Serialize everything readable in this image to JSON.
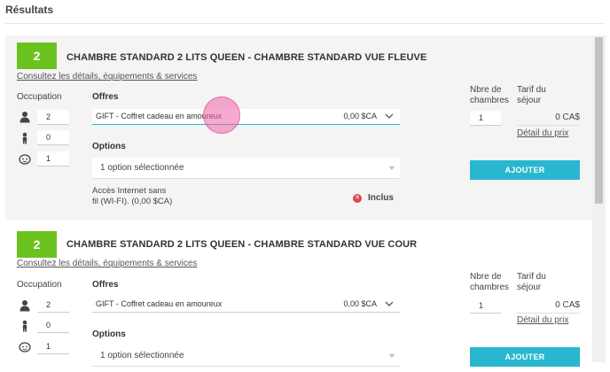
{
  "page": {
    "title": "Résultats"
  },
  "common": {
    "occupancy_label": "Occupation",
    "offers_label": "Offres",
    "options_label": "Options",
    "rooms_count_label_line1": "Nbre de",
    "rooms_count_label_line2": "chambres",
    "rate_label_line1": "Tarif du",
    "rate_label_line2": "séjour",
    "price_detail_link": "Détail du prix",
    "add_button": "AJOUTER",
    "details_link": "Consultez les détails, équipements & services"
  },
  "rooms": [
    {
      "badge": "2",
      "title": "CHAMBRE STANDARD 2 LITS QUEEN - CHAMBRE STANDARD VUE FLEUVE",
      "adults": "2",
      "children": "0",
      "infants": "1",
      "offer_value": "GIFT - Coffret cadeau en amoureux",
      "offer_price": "0,00 $CA",
      "options_value": "1 option sélectionnée",
      "internet_line1": "Accès Internet sans",
      "internet_line2": "fil (WI-FI). (0,00 $CA)",
      "included_label": "Inclus",
      "rooms_count": "1",
      "rate": "0 CA$"
    },
    {
      "badge": "2",
      "title": "CHAMBRE STANDARD 2 LITS QUEEN - CHAMBRE STANDARD VUE COUR",
      "adults": "2",
      "children": "0",
      "infants": "1",
      "offer_value": "GIFT - Coffret cadeau en amoureux",
      "offer_price": "0,00 $CA",
      "options_value": "1 option sélectionnée",
      "rooms_count": "1",
      "rate": "0 CA$"
    }
  ],
  "icons": {
    "adult": "adult-icon",
    "child": "child-icon",
    "infant": "infant-icon",
    "chevron": "chevron-down-icon",
    "included": "close-circle-icon"
  },
  "colors": {
    "badge": "#6cc21f",
    "accent": "#29b6cf",
    "included_icon": "#e0464c",
    "cursor": "#f064aa"
  }
}
